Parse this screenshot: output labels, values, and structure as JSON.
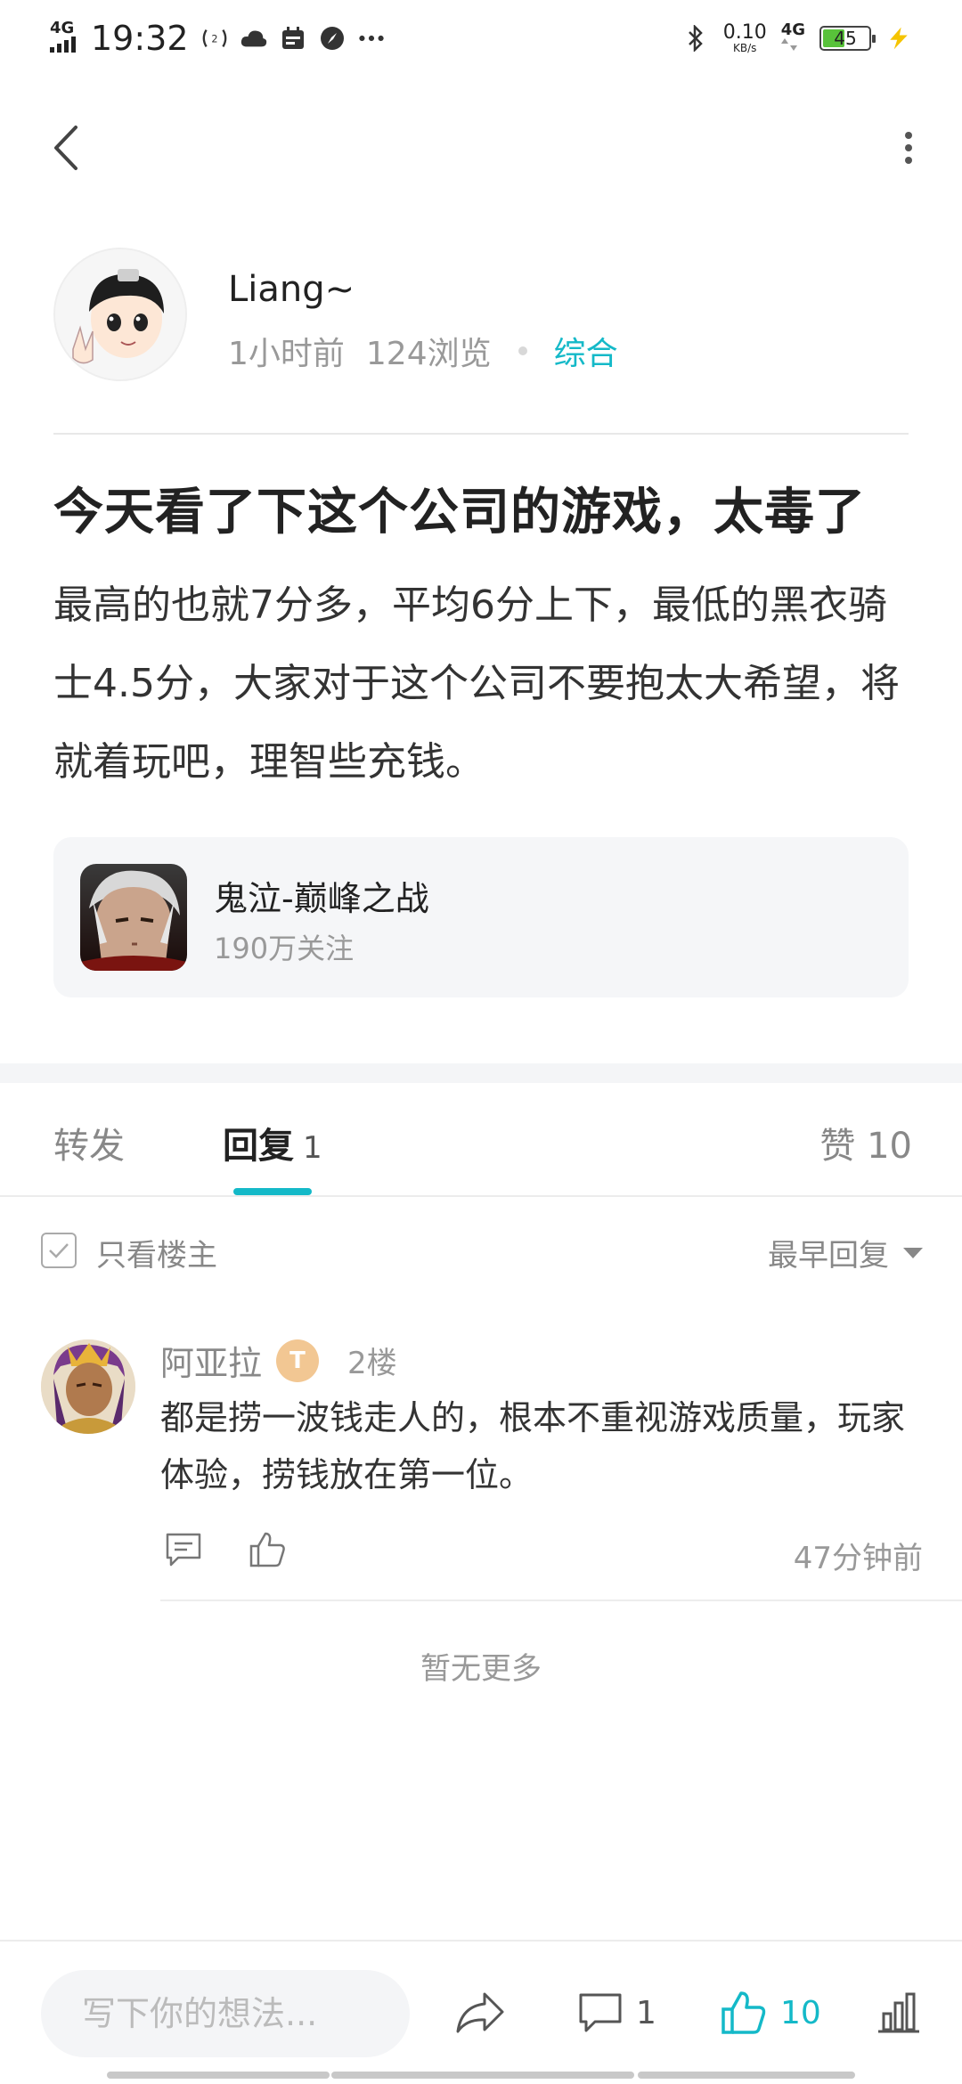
{
  "status_bar": {
    "network": "4G",
    "time": "19:32",
    "speed_value": "0.10",
    "speed_unit": "KB/s",
    "network_right": "4G",
    "battery": "45"
  },
  "post": {
    "author_name": "Liang~",
    "time_ago": "1小时前",
    "views": "124浏览",
    "category": "综合",
    "title": "今天看了下这个公司的游戏，太毒了",
    "body": "最高的也就7分多，平均6分上下，最低的黑衣骑士4.5分，大家对于这个公司不要抱太大希望，将就着玩吧，理智些充钱。",
    "game": {
      "name": "鬼泣-巅峰之战",
      "followers": "190万关注"
    }
  },
  "tabs": {
    "forward": "转发",
    "reply": "回复",
    "reply_count": "1",
    "like": "赞 10"
  },
  "filter": {
    "only_op": "只看楼主",
    "sort": "最早回复"
  },
  "replies": [
    {
      "name": "阿亚拉",
      "badge": "T",
      "floor": "2楼",
      "text": "都是捞一波钱走人的，根本不重视游戏质量，玩家体验，捞钱放在第一位。",
      "time": "47分钟前"
    }
  ],
  "no_more": "暂无更多",
  "bottom_bar": {
    "input_placeholder": "写下你的想法...",
    "comment_count": "1",
    "like_count": "10"
  },
  "colors": {
    "accent": "#14b9c8"
  }
}
